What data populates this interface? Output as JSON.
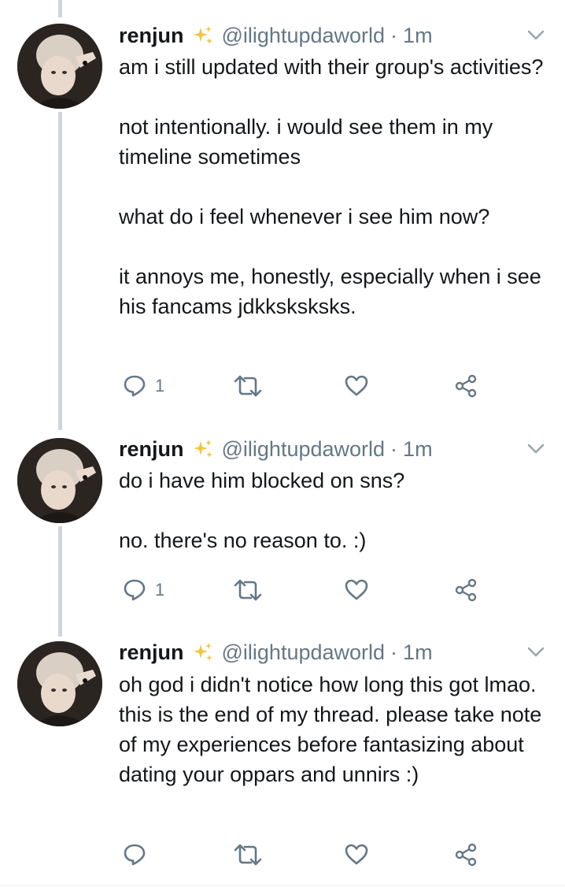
{
  "colors": {
    "text": "#14171a",
    "secondary": "#657786",
    "thread_line": "#cdd6dd",
    "sparkle": "#f5c542"
  },
  "tweets": [
    {
      "name": "renjun",
      "badge_icon": "sparkles-icon",
      "handle": "@ilightupdaworld",
      "separator": "·",
      "time": "1m",
      "paragraphs": [
        "am i still updated with their group's activities?",
        "not intentionally. i would see them in my timeline sometimes",
        "what do i feel whenever i see him now?",
        "it annoys me, honestly, especially when i see his fancams jdkksksksks."
      ],
      "reply_count": "1",
      "retweet_count": "",
      "like_count": ""
    },
    {
      "name": "renjun",
      "badge_icon": "sparkles-icon",
      "handle": "@ilightupdaworld",
      "separator": "·",
      "time": "1m",
      "paragraphs": [
        "do i have him blocked on sns?",
        "no. there's no reason to. :)"
      ],
      "reply_count": "1",
      "retweet_count": "",
      "like_count": ""
    },
    {
      "name": "renjun",
      "badge_icon": "sparkles-icon",
      "handle": "@ilightupdaworld",
      "separator": "·",
      "time": "1m",
      "paragraphs": [
        "oh god i didn't notice how long this got lmao. this is the end of my thread. please take note of my experiences before fantasizing about dating your oppars and unnirs :)"
      ],
      "reply_count": "",
      "retweet_count": "",
      "like_count": ""
    }
  ]
}
